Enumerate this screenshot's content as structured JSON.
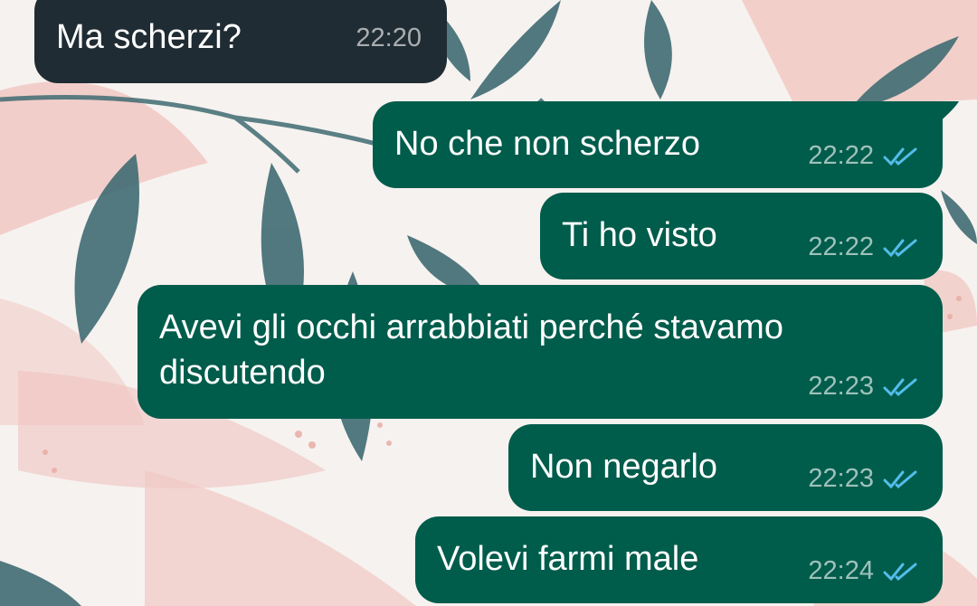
{
  "colors": {
    "incoming_bubble": "#202c33",
    "outgoing_bubble": "#005c4b",
    "read_ticks": "#53bdeb",
    "wallpaper_bg": "#f6f2ef"
  },
  "messages": [
    {
      "direction": "incoming",
      "text": "Ma scherzi?",
      "time": "22:20"
    },
    {
      "direction": "outgoing",
      "text": "No che non scherzo",
      "time": "22:22",
      "status_icon": "double-check-read-icon"
    },
    {
      "direction": "outgoing",
      "text": "Ti ho visto",
      "time": "22:22",
      "status_icon": "double-check-read-icon"
    },
    {
      "direction": "outgoing",
      "text_line1": "Avevi gli occhi arrabbiati perché stavamo",
      "text_line2": "discutendo",
      "time": "22:23",
      "status_icon": "double-check-read-icon"
    },
    {
      "direction": "outgoing",
      "text": "Non negarlo",
      "time": "22:23",
      "status_icon": "double-check-read-icon"
    },
    {
      "direction": "outgoing",
      "text": "Volevi farmi male",
      "time": "22:24",
      "status_icon": "double-check-read-icon"
    }
  ]
}
